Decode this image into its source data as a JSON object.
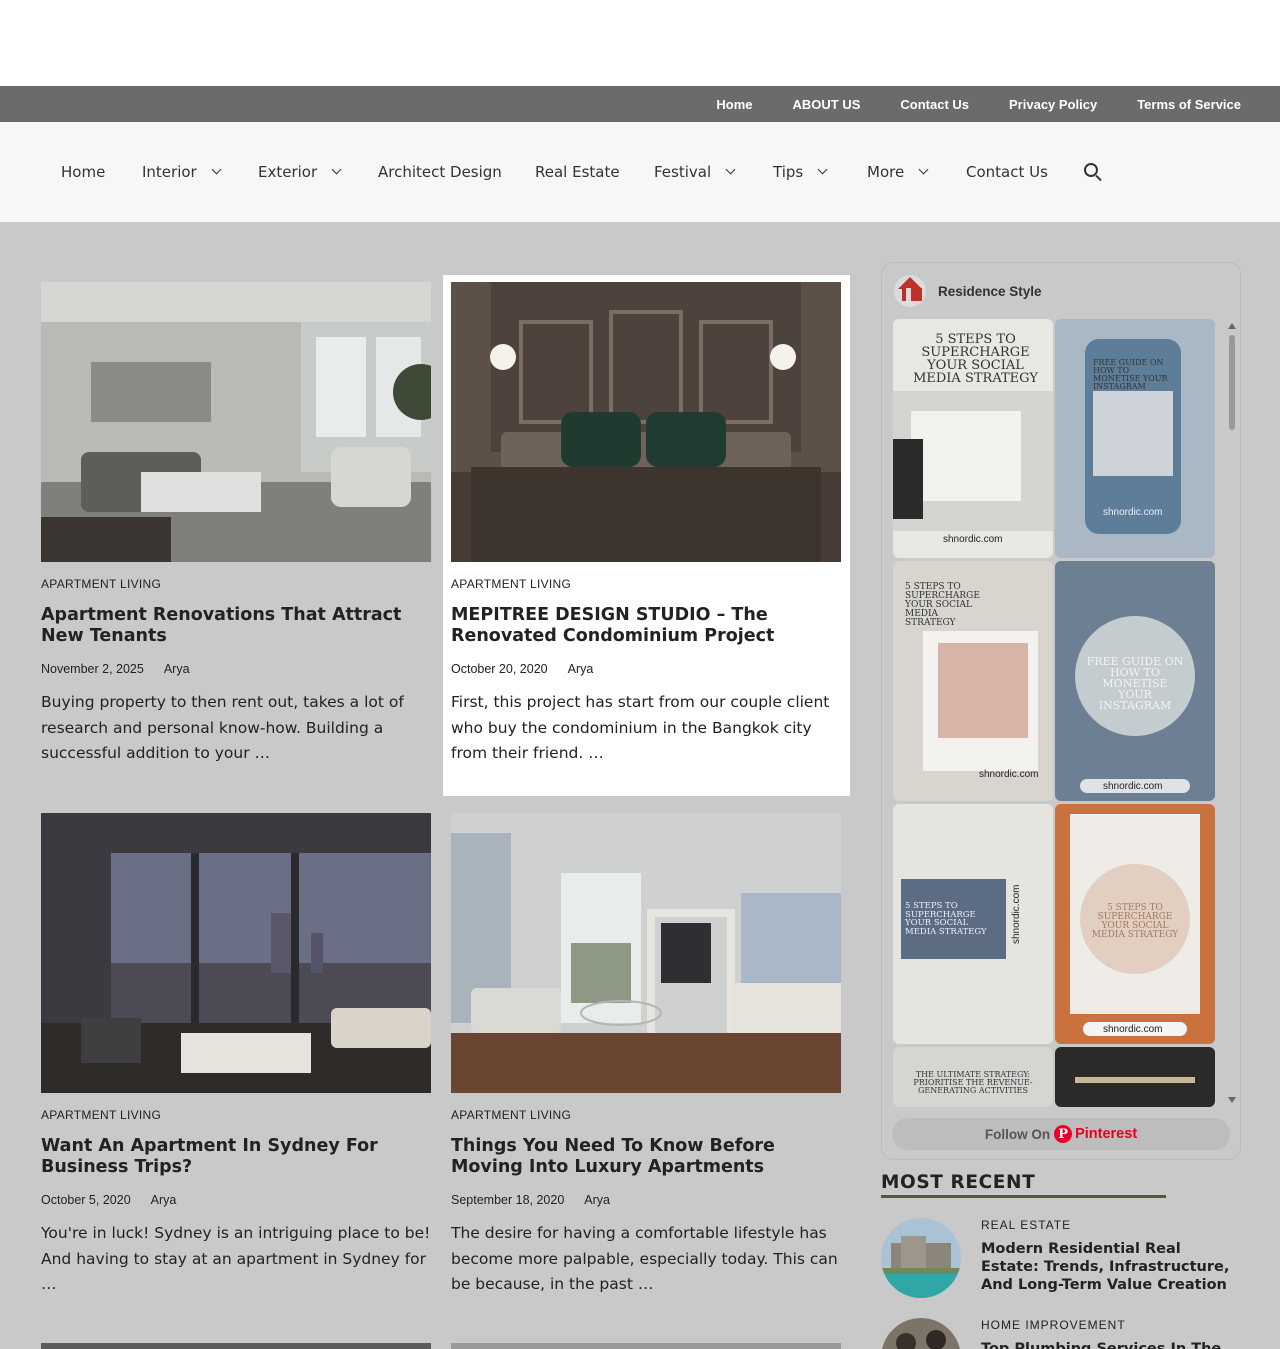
{
  "top_menu": [
    "Home",
    "ABOUT US",
    "Contact Us",
    "Privacy Policy",
    "Terms of Service"
  ],
  "main_nav": [
    {
      "label": "Home",
      "dropdown": false
    },
    {
      "label": "Interior",
      "dropdown": true
    },
    {
      "label": "Exterior",
      "dropdown": true
    },
    {
      "label": "Architect Design",
      "dropdown": false
    },
    {
      "label": "Real Estate",
      "dropdown": false
    },
    {
      "label": "Festival",
      "dropdown": true
    },
    {
      "label": "Tips",
      "dropdown": true
    },
    {
      "label": "More",
      "dropdown": true
    },
    {
      "label": "Contact Us",
      "dropdown": false
    }
  ],
  "posts": [
    {
      "category": "APARTMENT LIVING",
      "title": "Apartment Renovations That Attract New Tenants",
      "date": "November 2, 2025",
      "author": "Arya",
      "excerpt": "Buying property to then rent out, takes a lot of research and personal know-how. Building a successful addition to your …"
    },
    {
      "category": "APARTMENT LIVING",
      "title": "MEPITREE DESIGN STUDIO – The Renovated Condominium Project",
      "date": "October 20, 2020",
      "author": "Arya",
      "excerpt": "First, this project has start from our couple client who buy the condominium in the Bangkok city from their friend. …"
    },
    {
      "category": "APARTMENT LIVING",
      "title": "Want An Apartment In Sydney For Business Trips?",
      "date": "October 5, 2020",
      "author": "Arya",
      "excerpt": "You're in luck! Sydney is an intriguing place to be! And having to stay at an apartment in Sydney for …"
    },
    {
      "category": "APARTMENT LIVING",
      "title": "Things You Need To Know Before Moving Into Luxury Apartments",
      "date": "September 18, 2020",
      "author": "Arya",
      "excerpt": "The desire for having a comfortable lifestyle has become more palpable, especially today. This can be because, in the past …"
    }
  ],
  "pinterest": {
    "board": "Residence Style",
    "follow_text": "Follow On",
    "brand": "Pinterest",
    "pins": [
      {
        "text": "5 STEPS TO SUPERCHARGE YOUR SOCIAL MEDIA STRATEGY",
        "site": "shnordic.com"
      },
      {
        "text": "FREE GUIDE ON HOW TO MONETISE YOUR INSTAGRAM",
        "site": "shnordic.com"
      },
      {
        "text": "5 STEPS TO SUPERCHARGE YOUR SOCIAL MEDIA STRATEGY",
        "site": "shnordic.com"
      },
      {
        "text": "FREE GUIDE ON HOW TO MONETISE YOUR INSTAGRAM",
        "site": "shnordic.com"
      },
      {
        "text": "5 STEPS TO SUPERCHARGE YOUR SOCIAL MEDIA STRATEGY",
        "site": "shnordic.com"
      },
      {
        "text": "5 STEPS TO SUPERCHARGE YOUR SOCIAL MEDIA STRATEGY",
        "site": "shnordic.com"
      },
      {
        "text": "THE ULTIMATE STRATEGY: PRIORITISE THE REVENUE-GENERATING ACTIVITIES",
        "site": ""
      }
    ]
  },
  "most_recent": {
    "heading": "MOST RECENT",
    "items": [
      {
        "category": "REAL ESTATE",
        "title": "Modern Residential Real Estate: Trends, Infrastructure, And Long-Term Value Creation"
      },
      {
        "category": "HOME IMPROVEMENT",
        "title": "Top Plumbing Services In The USA"
      }
    ]
  }
}
